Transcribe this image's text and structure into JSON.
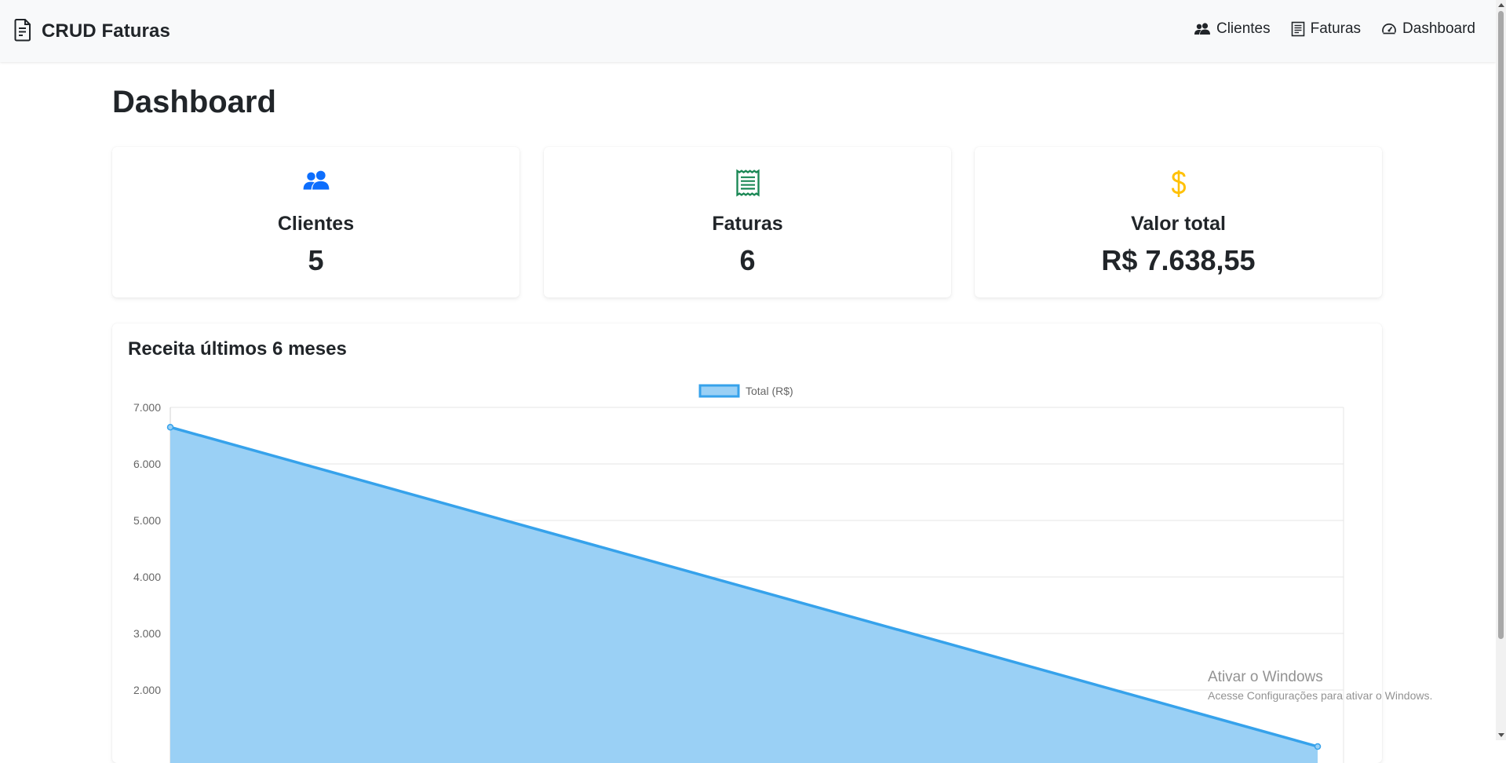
{
  "brand": {
    "name": "CRUD Faturas",
    "icon": "file-text-icon"
  },
  "nav": {
    "items": [
      {
        "label": "Clientes",
        "icon": "people-icon"
      },
      {
        "label": "Faturas",
        "icon": "receipt-icon"
      },
      {
        "label": "Dashboard",
        "icon": "speedometer-icon"
      }
    ]
  },
  "page": {
    "title": "Dashboard"
  },
  "stats": [
    {
      "label": "Clientes",
      "value": "5",
      "icon": "people-icon",
      "color": "#0d6efd"
    },
    {
      "label": "Faturas",
      "value": "6",
      "icon": "receipt-icon",
      "color": "#198754"
    },
    {
      "label": "Valor total",
      "value": "R$ 7.638,55",
      "icon": "dollar-icon",
      "color": "#ffc107"
    }
  ],
  "chart_card": {
    "title": "Receita últimos 6 meses"
  },
  "chart_data": {
    "type": "area",
    "series": [
      {
        "name": "Total (R$)",
        "values": [
          6650,
          1000
        ],
        "color": "#36a2eb",
        "fill": "#9ad0f5"
      }
    ],
    "y_ticks": [
      "7.000",
      "6.000",
      "5.000",
      "4.000",
      "3.000",
      "2.000"
    ],
    "ylim": [
      1000,
      7000
    ],
    "legend_position": "top-center",
    "grid": true
  },
  "watermark": {
    "title": "Ativar o Windows",
    "subtitle": "Acesse Configurações para ativar o Windows."
  }
}
